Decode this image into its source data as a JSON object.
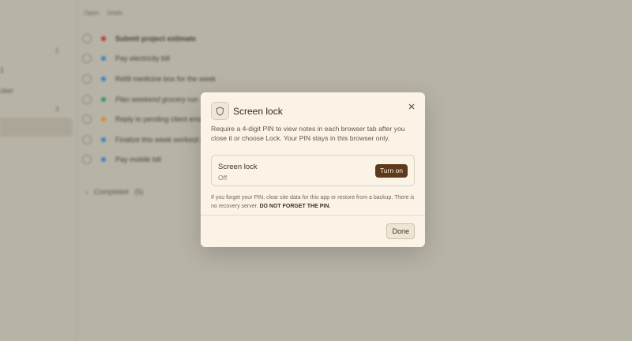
{
  "sidebar": {
    "items": [
      {
        "label": "1"
      },
      {
        "label": "cker"
      }
    ],
    "counts": [
      "2",
      "3"
    ]
  },
  "main": {
    "tabs": [
      "Open",
      "Undo"
    ],
    "tasks": [
      {
        "title": "Submit project estimate",
        "color": "#c0392b",
        "bold": true
      },
      {
        "title": "Pay electricity bill",
        "color": "#3b82c4"
      },
      {
        "title": "Refill medicine box for the week",
        "color": "#3b82c4"
      },
      {
        "title": "Plan weekend grocery run",
        "color": "#2e9b5a"
      },
      {
        "title": "Reply to pending client ema",
        "color": "#d4901a"
      },
      {
        "title": "Finalize this week workout s",
        "color": "#3b82c4"
      },
      {
        "title": "Pay mobile bill",
        "color": "#3b82c4"
      }
    ],
    "completed_label": "Completed",
    "completed_count": "(5)"
  },
  "modal": {
    "title": "Screen lock",
    "description": "Require a 4-digit PIN to view notes in each browser tab after you close it or choose Lock. Your PIN stays in this browser only.",
    "card_title": "Screen lock",
    "card_status": "Off",
    "turn_on_label": "Turn on",
    "note_text": "If you forget your PIN, clear site data for this app or restore from a backup. There is no recovery server.",
    "note_emphasis": "DO NOT FORGET THE PIN.",
    "done_label": "Done",
    "icon": "shield-icon",
    "close_icon": "close-icon"
  }
}
